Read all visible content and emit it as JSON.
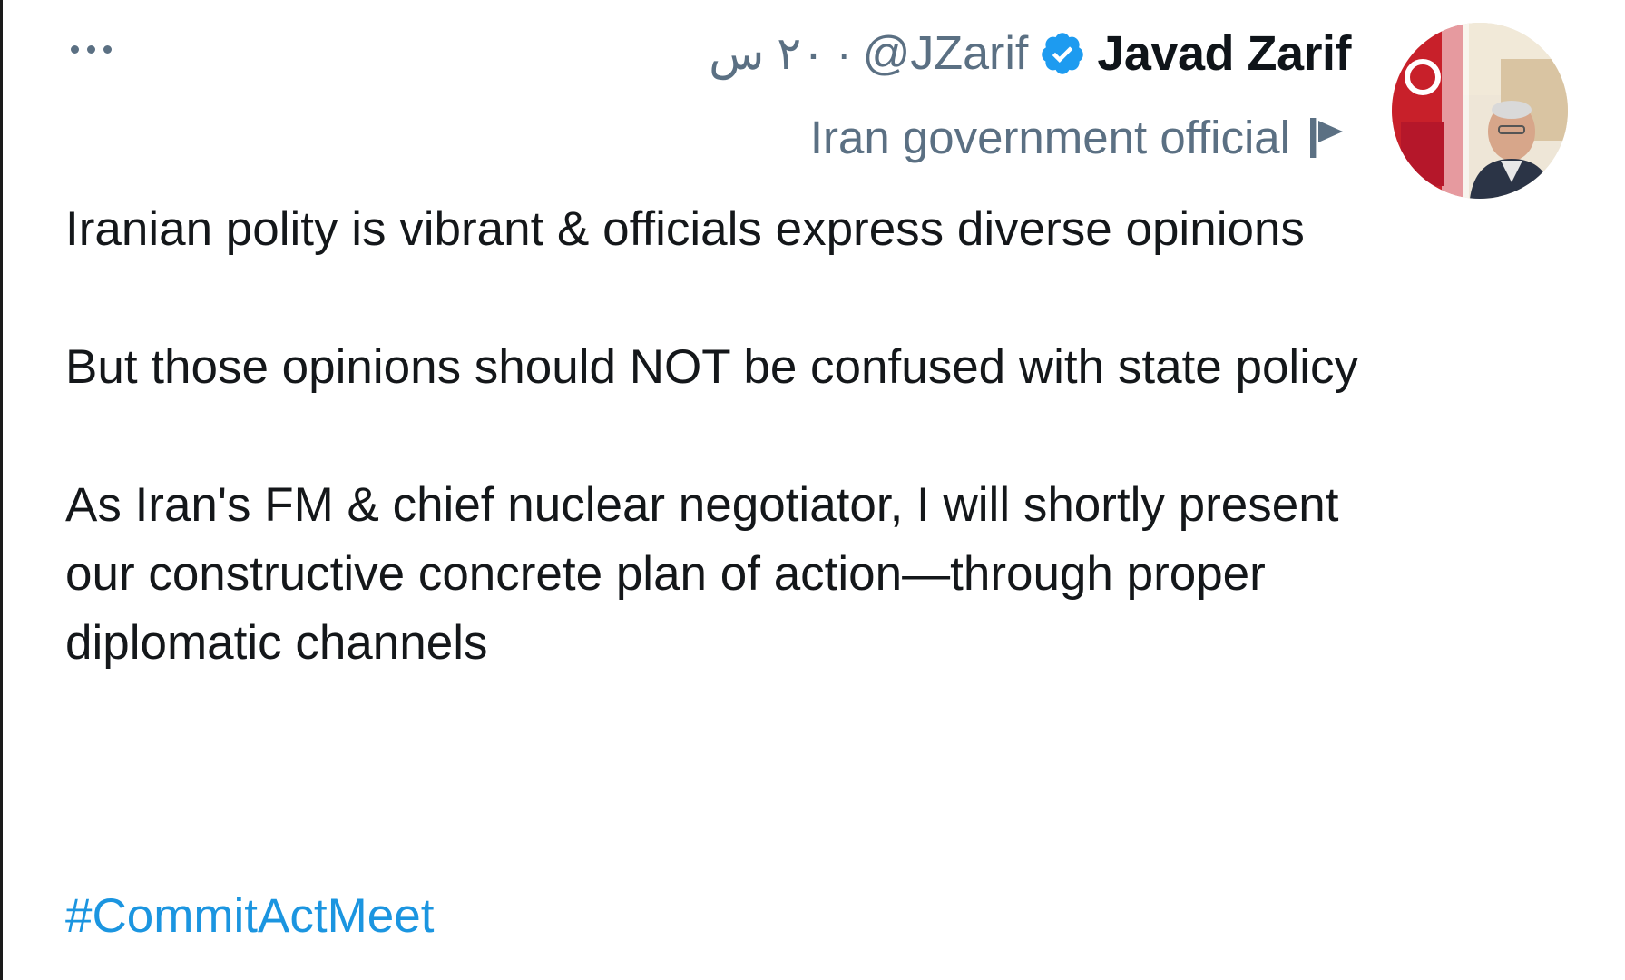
{
  "tweet": {
    "author_name": "Javad Zarif",
    "handle": "@JZarif",
    "separator": "·",
    "time": "۲۰ س",
    "account_label": "Iran government official",
    "paragraphs": [
      "Iranian polity is vibrant & officials express diverse opinions",
      "But those opinions should NOT be confused with state policy",
      "As Iran's FM & chief nuclear negotiator, I will shortly present our constructive concrete plan of action—through proper diplomatic channels"
    ],
    "hashtag": "#CommitActMeet",
    "verified": true
  },
  "icons": {
    "more": "more-options-icon",
    "verified": "verified-badge-icon",
    "label": "flag-icon"
  },
  "colors": {
    "secondary_text": "#5b7083",
    "link": "#1b95e0",
    "verified": "#1d9bf0",
    "primary_text": "#14171a"
  }
}
